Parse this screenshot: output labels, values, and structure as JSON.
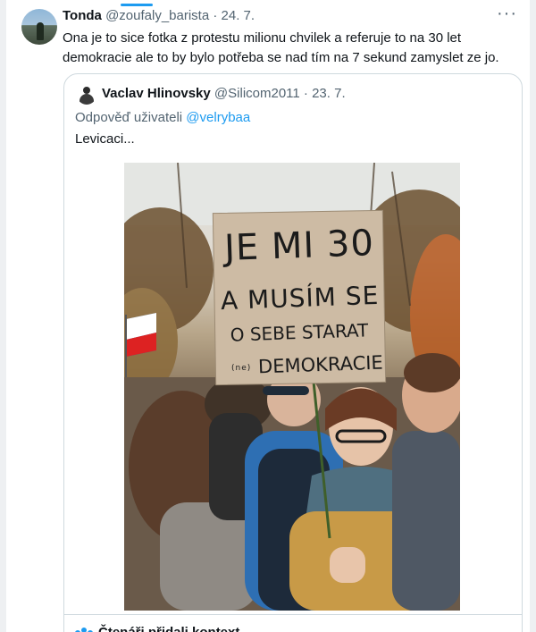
{
  "tweet": {
    "author_name": "Tonda",
    "author_handle": "@zoufaly_barista",
    "separator": "·",
    "date": "24. 7.",
    "more_label": "···",
    "text": "Ona je to sice fotka z protestu milionu chvilek a referuje to na 30 let demokracie ale to by bylo potřeba se nad tím na 7 sekund zamyslet ze jo."
  },
  "quoted": {
    "author_name": "Vaclav Hlinovsky",
    "author_handle": "@Silicom2011",
    "separator": "·",
    "date": "23. 7.",
    "reply_prefix": "Odpověď uživateli",
    "reply_handle": "@velrybaa",
    "text": "Levicaci...",
    "photo": {
      "sign_line1": "JE MI 30",
      "sign_line2": "A MUSÍM SE",
      "sign_line3": "O SEBE STARAT",
      "sign_small": "(ne)",
      "sign_line4": "DEMOKRACIE"
    }
  },
  "context": {
    "label": "Čtenáři přidali kontext",
    "icon": "people-icon",
    "accent": "#1d9bf0"
  }
}
